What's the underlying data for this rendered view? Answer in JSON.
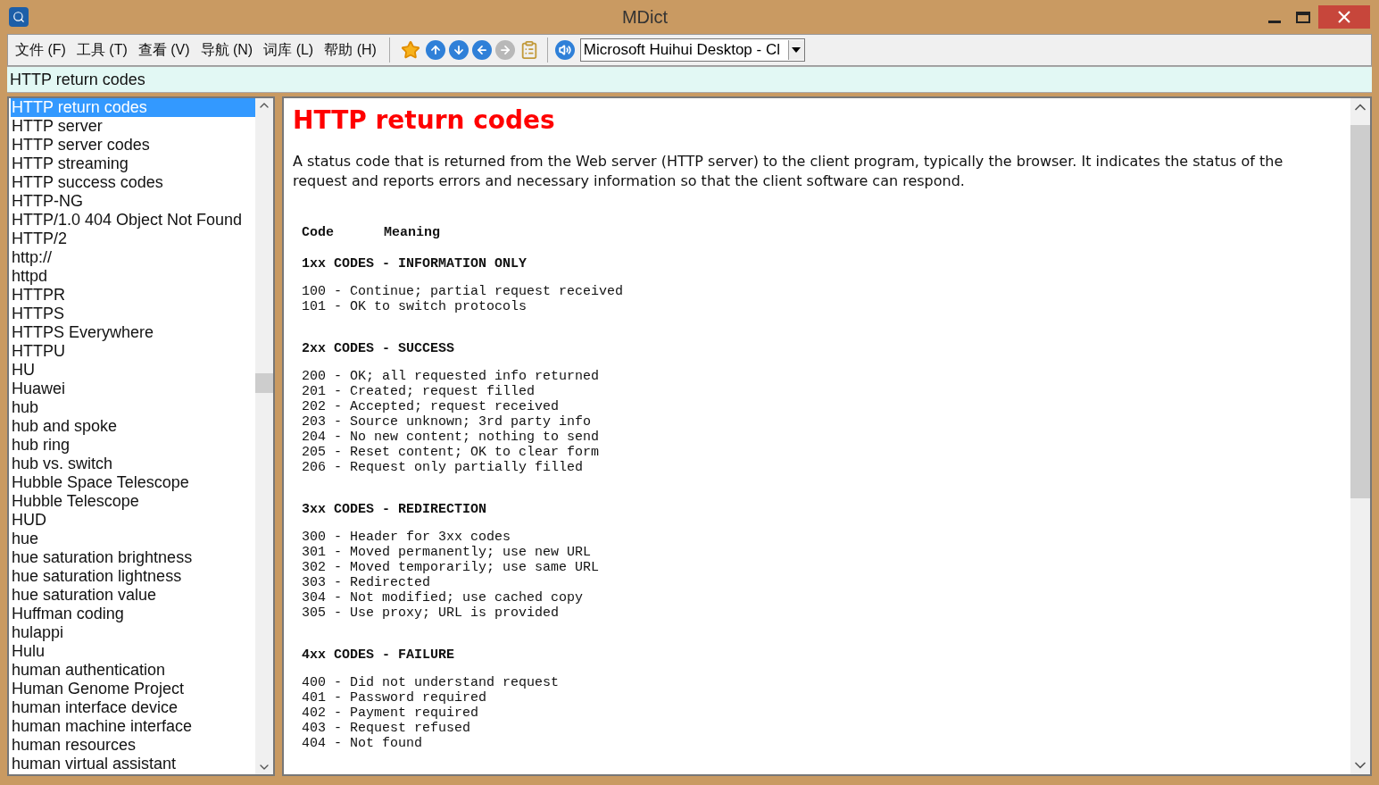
{
  "window": {
    "title": "MDict"
  },
  "menu": [
    "文件 (F)",
    "工具 (T)",
    "查看 (V)",
    "导航 (N)",
    "词库 (L)",
    "帮助 (H)"
  ],
  "dictionary_select": {
    "value": "Microsoft Huihui Desktop - Cl"
  },
  "search": {
    "value": "HTTP return codes"
  },
  "word_list": [
    {
      "label": "HTTP return codes",
      "selected": true
    },
    {
      "label": "HTTP server",
      "selected": false
    },
    {
      "label": "HTTP server codes",
      "selected": false
    },
    {
      "label": "HTTP streaming",
      "selected": false
    },
    {
      "label": "HTTP success codes",
      "selected": false
    },
    {
      "label": "HTTP-NG",
      "selected": false
    },
    {
      "label": "HTTP/1.0 404 Object Not Found",
      "selected": false
    },
    {
      "label": "HTTP/2",
      "selected": false
    },
    {
      "label": "http://",
      "selected": false
    },
    {
      "label": "httpd",
      "selected": false
    },
    {
      "label": "HTTPR",
      "selected": false
    },
    {
      "label": "HTTPS",
      "selected": false
    },
    {
      "label": "HTTPS Everywhere",
      "selected": false
    },
    {
      "label": "HTTPU",
      "selected": false
    },
    {
      "label": "HU",
      "selected": false
    },
    {
      "label": "Huawei",
      "selected": false
    },
    {
      "label": "hub",
      "selected": false
    },
    {
      "label": "hub and spoke",
      "selected": false
    },
    {
      "label": "hub ring",
      "selected": false
    },
    {
      "label": "hub vs. switch",
      "selected": false
    },
    {
      "label": "Hubble Space Telescope",
      "selected": false
    },
    {
      "label": "Hubble Telescope",
      "selected": false
    },
    {
      "label": "HUD",
      "selected": false
    },
    {
      "label": "hue",
      "selected": false
    },
    {
      "label": "hue saturation brightness",
      "selected": false
    },
    {
      "label": "hue saturation lightness",
      "selected": false
    },
    {
      "label": "hue saturation value",
      "selected": false
    },
    {
      "label": "Huffman coding",
      "selected": false
    },
    {
      "label": "hulappi",
      "selected": false
    },
    {
      "label": "Hulu",
      "selected": false
    },
    {
      "label": "human authentication",
      "selected": false
    },
    {
      "label": "Human Genome Project",
      "selected": false
    },
    {
      "label": "human interface device",
      "selected": false
    },
    {
      "label": "human machine interface",
      "selected": false
    },
    {
      "label": "human resources",
      "selected": false
    },
    {
      "label": "human virtual assistant",
      "selected": false
    }
  ],
  "entry": {
    "title": "HTTP return codes",
    "description": "A status code that is returned from the Web server (HTTP server) to the client program, typically the browser. It indicates the status of the request and reports errors and necessary information so that the client software can respond.",
    "columns": [
      "Code",
      "Meaning"
    ],
    "sections": [
      {
        "heading": "1xx CODES - INFORMATION ONLY",
        "lines": [
          "100 - Continue; partial request received",
          "101 - OK to switch protocols"
        ]
      },
      {
        "heading": "2xx CODES - SUCCESS",
        "lines": [
          "200 - OK; all requested info returned",
          "201 - Created; request filled",
          "202 - Accepted; request received",
          "203 - Source unknown; 3rd party info",
          "204 - No new content; nothing to send",
          "205 - Reset content; OK to clear form",
          "206 - Request only partially filled"
        ]
      },
      {
        "heading": "3xx CODES - REDIRECTION",
        "lines": [
          "300 - Header for 3xx codes",
          "301 - Moved permanently; use new URL",
          "302 - Moved temporarily; use same URL",
          "303 - Redirected",
          "304 - Not modified; use cached copy",
          "305 - Use proxy; URL is provided"
        ]
      },
      {
        "heading": "4xx CODES - FAILURE",
        "lines": [
          "400 - Did not understand request",
          "401 - Password required",
          "402 - Payment required",
          "403 - Request refused",
          "404 - Not found"
        ]
      }
    ]
  }
}
